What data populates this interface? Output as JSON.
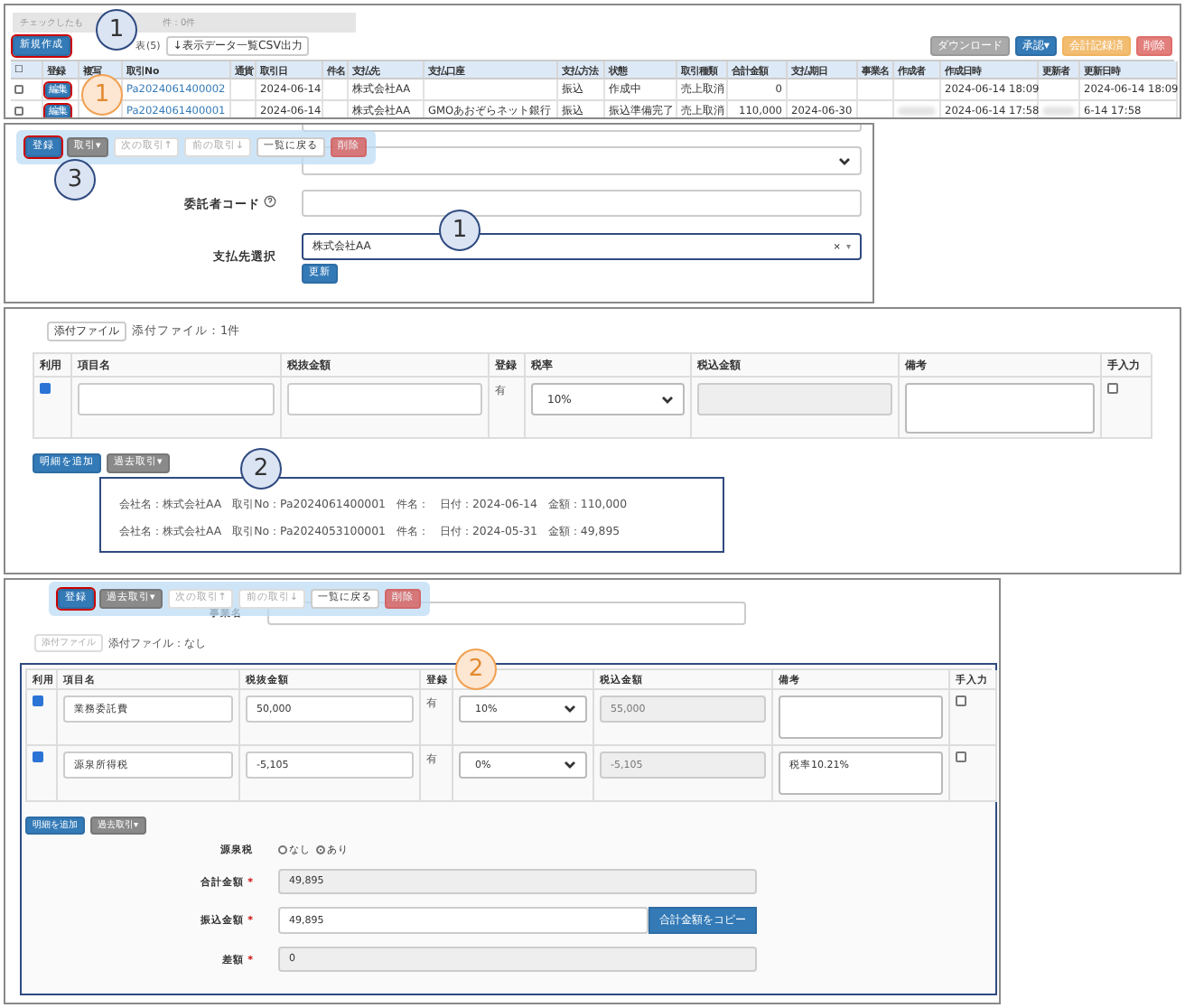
{
  "list_screen": {
    "notice": "チェックしたも",
    "notice_count": "件：0件",
    "new_button": {
      "label": "新規作成",
      "highlighted": true
    },
    "filter_text": "表(5)",
    "csv_button": "↓表示データ一覧CSV出力",
    "right_buttons": [
      {
        "label": "ダウンロード",
        "kind": "muted"
      },
      {
        "label": "承認▾",
        "kind": "primary"
      },
      {
        "label": "会計記録済",
        "kind": "warning"
      },
      {
        "label": "削除",
        "kind": "danger"
      }
    ],
    "columns": [
      "☐",
      "登録",
      "複写",
      "取引No",
      "通貨",
      "取引日",
      "件名",
      "支払先",
      "支払口座",
      "支払方法",
      "状態",
      "取引種類",
      "合計金額",
      "支払期日",
      "事業名",
      "作成者",
      "作成日時",
      "更新者",
      "更新日時"
    ],
    "rows": [
      {
        "checked": false,
        "button": "編集",
        "highlighted": true,
        "no": "Pa2024061400002",
        "date": "2024-06-14",
        "payee": "株式会社AA",
        "method": "振込",
        "status": "作成中",
        "type": "売上取消",
        "total": "0",
        "created": "2024-06-14 18:09",
        "updated": "2024-06-14 18:09",
        "names_blurred": false
      },
      {
        "checked": false,
        "button": "編集",
        "highlighted": true,
        "no": "Pa2024061400001",
        "date": "2024-06-14",
        "payee": "株式会社AA",
        "account": "GMOあおぞらネット銀行",
        "method": "振込",
        "status": "振込準備完了",
        "type": "売上取消",
        "total": "110,000",
        "due": "2024-06-30",
        "created": "2024-06-14 17:58",
        "updated": "6-14 17:58",
        "names_blurred": true
      }
    ],
    "callouts": [
      {
        "number": "1",
        "color": "#dbe4f3"
      },
      {
        "number": "1",
        "color": "#fde6d2"
      }
    ]
  },
  "form_screen": {
    "toolbar": [
      {
        "label": "登録",
        "kind": "primary",
        "highlighted": true
      },
      {
        "label": "取引▾",
        "kind": "secondary",
        "highlighted": false
      },
      {
        "label": "次の取引↑",
        "kind": "disabled",
        "highlighted": false
      },
      {
        "label": "前の取引↓",
        "kind": "disabled",
        "highlighted": false
      },
      {
        "label": "一覧に戻る",
        "kind": "default",
        "highlighted": false
      },
      {
        "label": "削除",
        "kind": "danger",
        "highlighted": false
      }
    ],
    "consignor_label": "委託者コード",
    "payee_label": "支払先選択",
    "payee_value": "株式会社AA",
    "payee_clear": "×",
    "payee_caret": "▾",
    "update_button": "更新",
    "callouts": [
      {
        "number": "3",
        "color": "#dbe4f3"
      },
      {
        "number": "1",
        "color": "#dbe4f3"
      }
    ]
  },
  "history_screen": {
    "attach_button": "添付ファイル",
    "attach_text": "添付ファイル：1件",
    "columns": [
      "利用",
      "項目名",
      "税抜金額",
      "登録",
      "税率",
      "税込金額",
      "備考",
      "手入力"
    ],
    "rows": [
      {
        "used": true,
        "registered": "有",
        "rate": "10%",
        "manual": false
      }
    ],
    "add_button": "明細を追加",
    "past_button": "過去取引▾",
    "history_items": [
      "会社名：株式会社AA　取引No：Pa2024061400001　件名：　日付：2024-06-14　金額：110,000",
      "会社名：株式会社AA　取引No：Pa2024053100001　件名：　日付：2024-05-31　金額：49,895"
    ],
    "callouts": [
      {
        "number": "2",
        "color": "#dbe4f3"
      }
    ]
  },
  "result_screen": {
    "toolbar": [
      {
        "label": "登録",
        "kind": "primary",
        "highlighted": true
      },
      {
        "label": "過去取引▾",
        "kind": "secondary",
        "highlighted": false
      },
      {
        "label": "次の取引↑",
        "kind": "disabled",
        "highlighted": false
      },
      {
        "label": "前の取引↓",
        "kind": "disabled",
        "highlighted": false
      },
      {
        "label": "一覧に戻る",
        "kind": "default",
        "highlighted": false
      },
      {
        "label": "削除",
        "kind": "danger",
        "highlighted": false
      }
    ],
    "project_label": "事業名",
    "attach_button": "添付ファイル",
    "attach_text": "添付ファイル：なし",
    "columns": [
      "利用",
      "項目名",
      "税抜金額",
      "登録",
      "",
      "税込金額",
      "備考",
      "手入力"
    ],
    "rows": [
      {
        "used": true,
        "item": "業務委託費",
        "amount": "50,000",
        "registered": "有",
        "rate": "10%",
        "taxed": "55,000",
        "manual": false
      },
      {
        "used": true,
        "item": "源泉所得税",
        "amount": "-5,105",
        "registered": "有",
        "rate": "0%",
        "taxed": "-5,105",
        "note": "税率10.21%",
        "manual": false
      }
    ],
    "add_button": "明細を追加",
    "past_button": "過去取引▾",
    "withholding_label": "源泉税",
    "withholding_options": [
      {
        "label": "なし",
        "selected": false
      },
      {
        "label": "あり",
        "selected": true
      }
    ],
    "total_label": "合計金額",
    "total_value": "49,895",
    "transfer_label": "振込金額",
    "transfer_value": "49,895",
    "copy_button": "合計金額をコピー",
    "diff_label": "差額",
    "diff_value": "0",
    "required_mark": "*",
    "callouts": [
      {
        "number": "2",
        "color": "#fde6d2"
      }
    ]
  }
}
